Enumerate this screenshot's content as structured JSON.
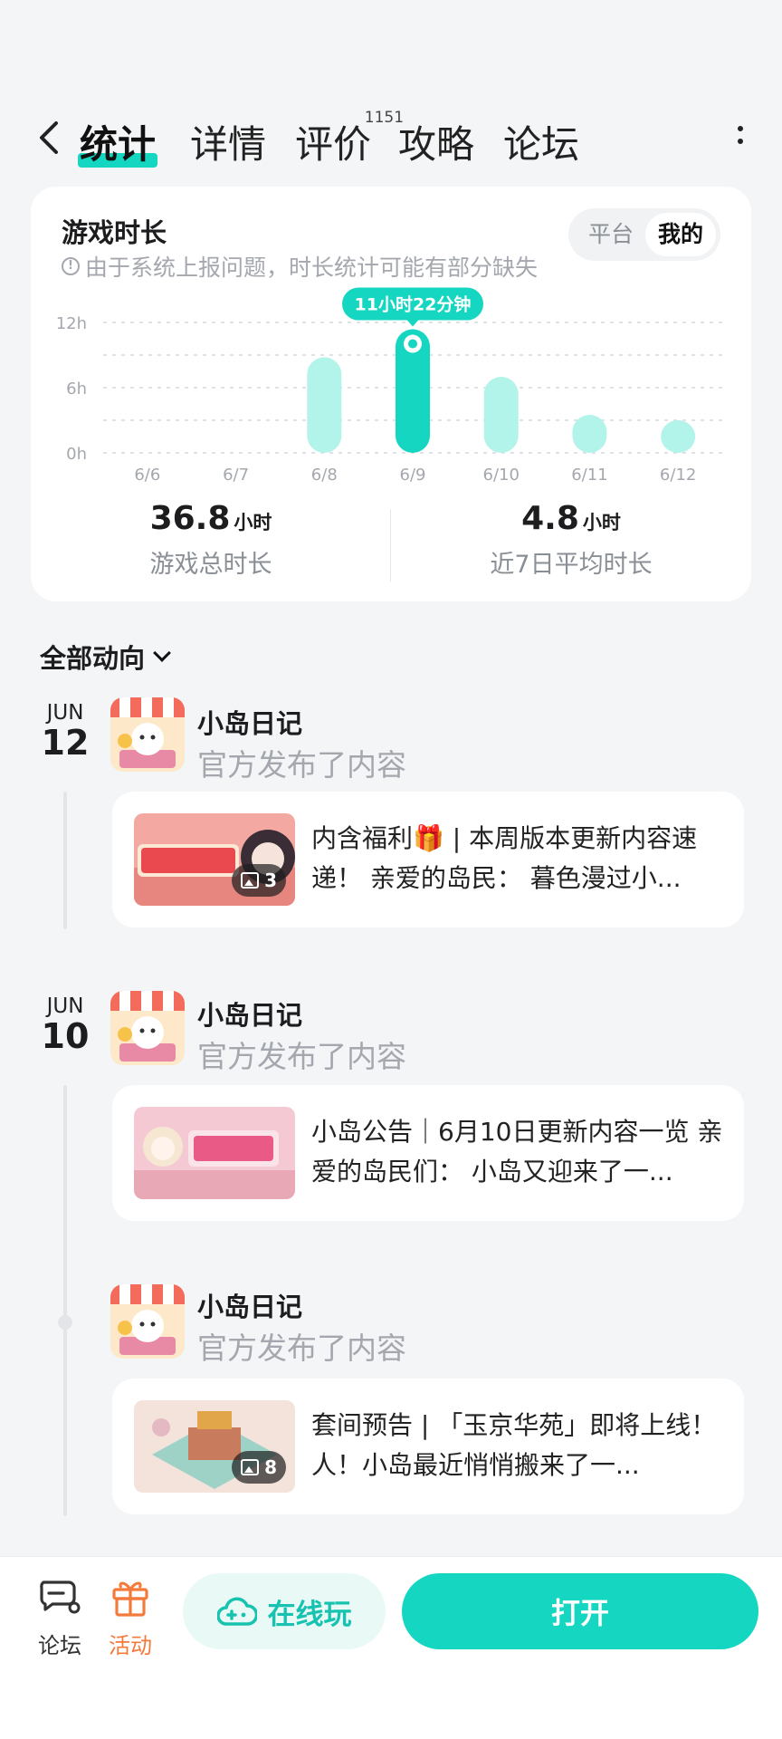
{
  "nav": {
    "tabs": [
      {
        "label": "统计"
      },
      {
        "label": "详情"
      },
      {
        "label": "评价",
        "badge": "1151"
      },
      {
        "label": "攻略"
      },
      {
        "label": "论坛"
      }
    ]
  },
  "stats": {
    "title": "游戏时长",
    "note": "由于系统上报问题，时长统计可能有部分缺失",
    "toggle": {
      "platform": "平台",
      "mine": "我的"
    },
    "tooltip": "11小时22分钟",
    "total": {
      "value": "36.8",
      "unit": "小时",
      "label": "游戏总时长"
    },
    "average": {
      "value": "4.8",
      "unit": "小时",
      "label": "近7日平均时长"
    }
  },
  "chart_data": {
    "type": "bar",
    "categories": [
      "6/6",
      "6/7",
      "6/8",
      "6/9",
      "6/10",
      "6/11",
      "6/12"
    ],
    "values": [
      0,
      0,
      8.8,
      11.37,
      7,
      3.5,
      3
    ],
    "highlight_index": 3,
    "y_ticks": [
      "0h",
      "6h",
      "12h"
    ],
    "ylim": [
      0,
      12
    ],
    "grid": true,
    "colors": {
      "bar": "#b2f3ea",
      "highlight": "#15d6c0"
    }
  },
  "feed": {
    "filter_label": "全部动向",
    "groups": [
      {
        "month": "JUN",
        "day": "12",
        "poster": "小岛日记",
        "action": "官方发布了内容",
        "post": {
          "text": "内含福利🎁 | 本周版本更新内容速递！ 亲爱的岛民： 暮色漫过小...",
          "image_count": "3"
        }
      },
      {
        "month": "JUN",
        "day": "10",
        "poster": "小岛日记",
        "action": "官方发布了内容",
        "post": {
          "text": "小岛公告｜6月10日更新内容一览 亲爱的岛民们： 小岛又迎来了一...",
          "image_count": ""
        }
      },
      {
        "month": "",
        "day": "",
        "poster": "小岛日记",
        "action": "官方发布了内容",
        "post": {
          "text": "套间预告 | 「玉京华苑」即将上线！ 人！小岛最近悄悄搬来了一...",
          "image_count": "8"
        }
      }
    ]
  },
  "bottom": {
    "forum": "论坛",
    "activity": "活动",
    "online_play": "在线玩",
    "open": "打开"
  },
  "colors": {
    "accent": "#15d6c0",
    "activity": "#f47a3c"
  }
}
